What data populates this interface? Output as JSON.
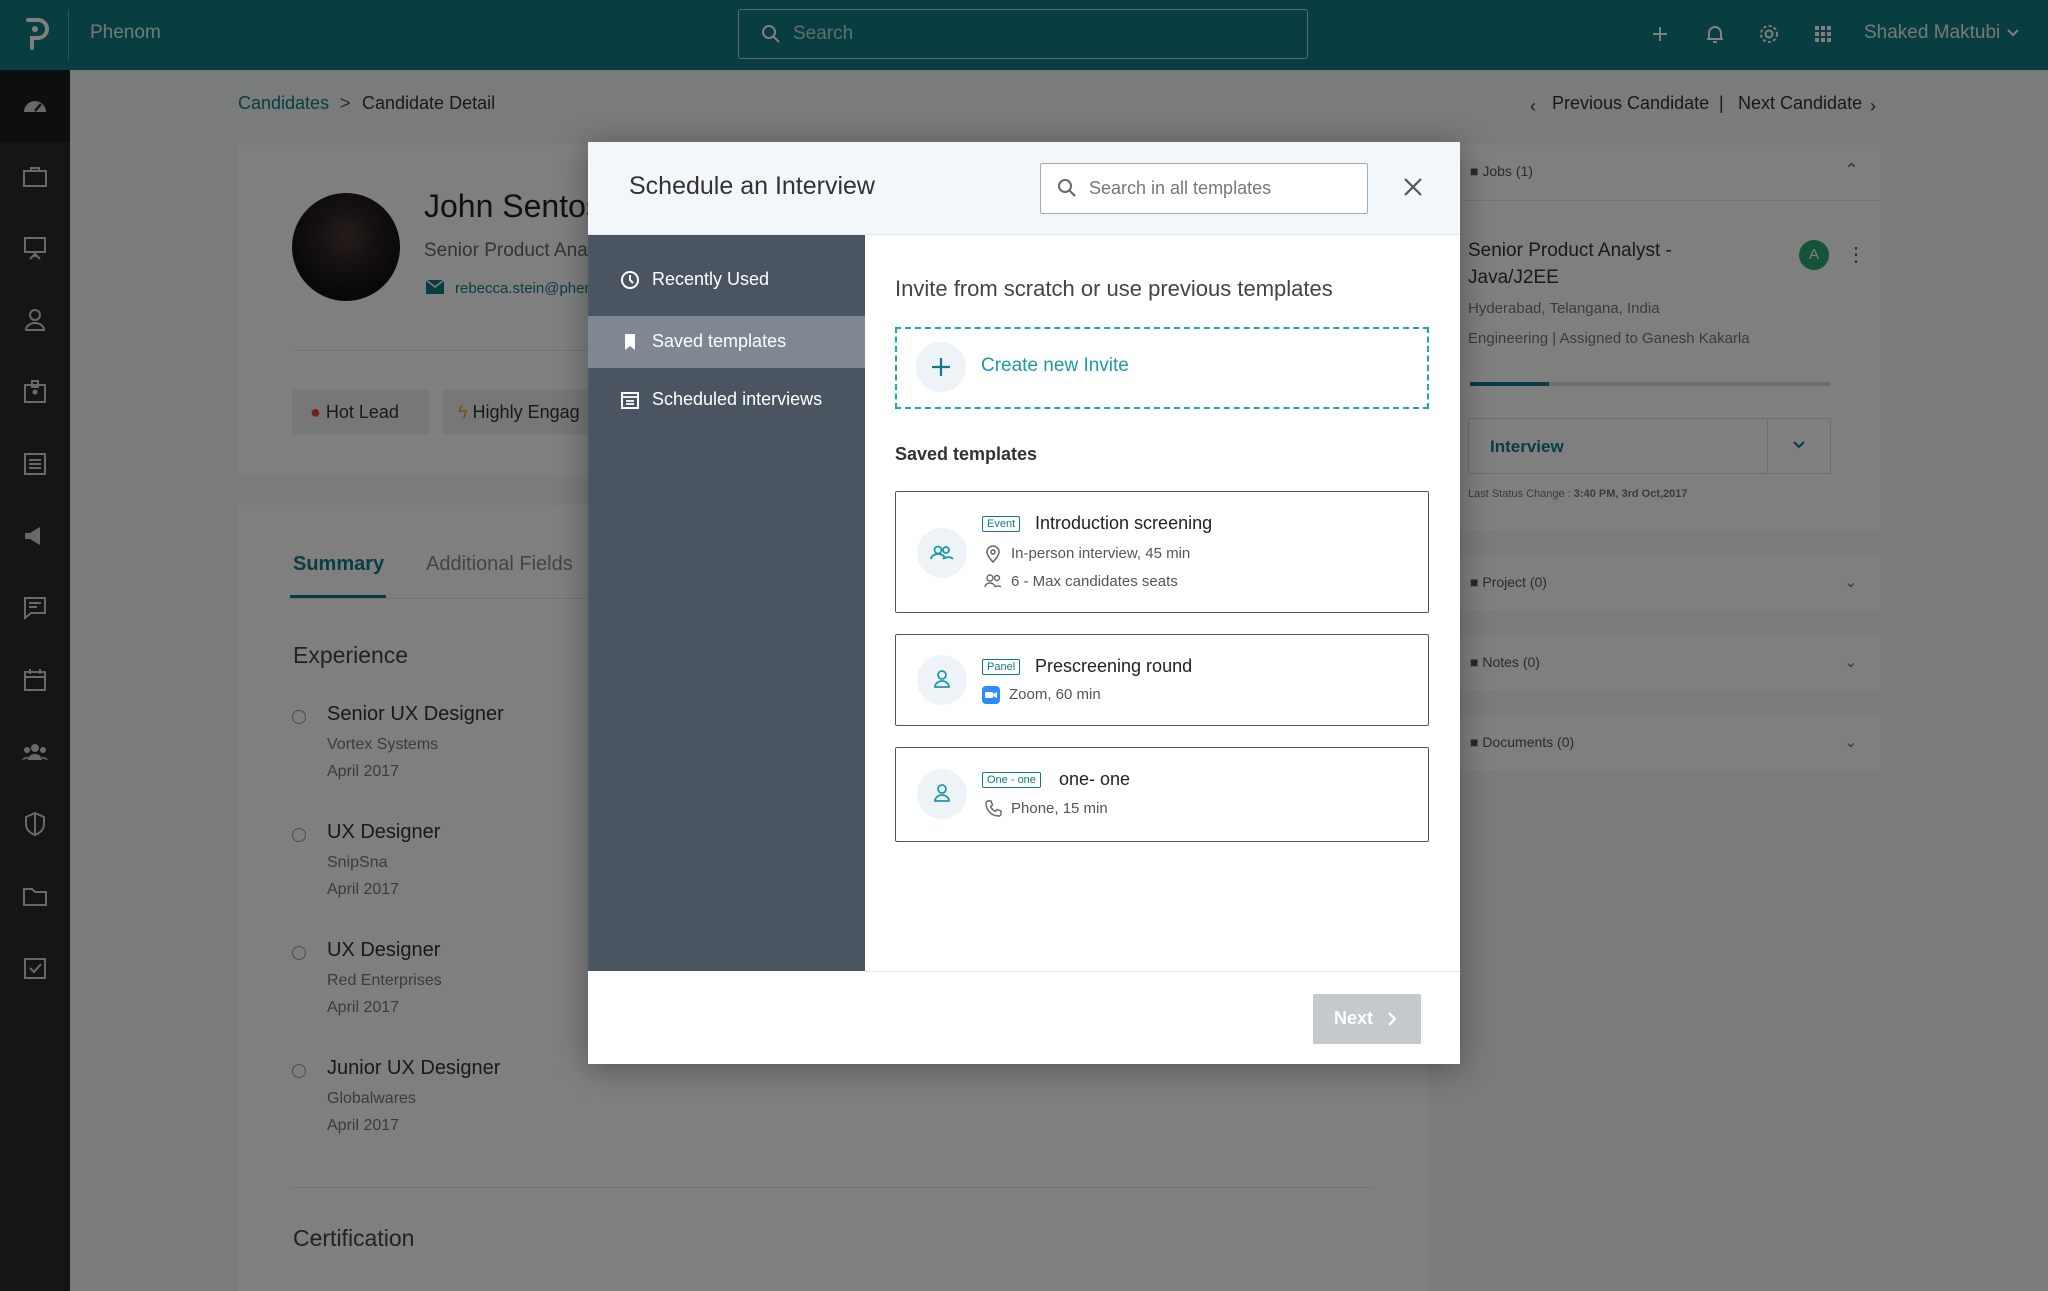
{
  "topbar": {
    "brand": "Phenom",
    "search_placeholder": "Search",
    "user_name": "Shaked Maktubi"
  },
  "breadcrumb": {
    "candidates": "Candidates",
    "separator": ">",
    "current": "Candidate Detail"
  },
  "candidate_nav": {
    "previous": "Previous Candidate",
    "separator": "|",
    "next": "Next Candidate"
  },
  "profile": {
    "name": "John Sentos",
    "title": "Senior Product Ana",
    "email": "rebecca.stein@phen",
    "tags": [
      "Hot Lead",
      "Highly Engag"
    ]
  },
  "summary": {
    "tabs": [
      "Summary",
      "Additional Fields"
    ],
    "experience_heading": "Experience",
    "experience": [
      {
        "role": "Senior UX Designer",
        "company": "Vortex Systems",
        "date": "April 2017"
      },
      {
        "role": "UX Designer",
        "company": "SnipSna",
        "date": "April 2017"
      },
      {
        "role": "UX Designer",
        "company": "Red Enterprises",
        "date": "April 2017"
      },
      {
        "role": "Junior UX Designer",
        "company": "Globalwares",
        "date": "April 2017"
      }
    ],
    "certification_heading": "Certification"
  },
  "right_panel": {
    "jobs_header": "Jobs (1)",
    "job_title_line1": "Senior Product Analyst -",
    "job_title_line2": "Java/J2EE",
    "job_location": "Hyderabad, Telangana, India",
    "job_meta": "Engineering | Assigned to Ganesh Kakarla",
    "job_avatar_letter": "A",
    "progress_fraction": 0.22,
    "status": "Interview",
    "last_status_label": "Last Status Change :",
    "last_status_value": "3:40 PM, 3rd Oct,2017",
    "project_header": "Project (0)",
    "notes_header": "Notes (0)",
    "documents_header": "Documents (0)"
  },
  "modal": {
    "title": "Schedule an Interview",
    "search_placeholder": "Search in all templates",
    "nav": [
      "Recently Used",
      "Saved templates",
      "Scheduled interviews"
    ],
    "active_nav": "Saved templates",
    "invite_heading": "Invite from scratch or use previous templates",
    "create_label": "Create new Invite",
    "saved_heading": "Saved templates",
    "templates": [
      {
        "badge": "Event",
        "name": "Introduction screening",
        "details": [
          "In-person interview, 45 min",
          "6 - Max candidates seats"
        ]
      },
      {
        "badge": "Panel",
        "name": "Prescreening round",
        "details": [
          "Zoom, 60 min"
        ]
      },
      {
        "badge": "One - one",
        "name": "one- one",
        "details": [
          "Phone, 15 min"
        ]
      }
    ],
    "next_label": "Next"
  },
  "colors": {
    "brand": "#117a84",
    "sidebar": "#262a2d",
    "modal_nav": "#4a5561",
    "accent": "#19aab8"
  }
}
